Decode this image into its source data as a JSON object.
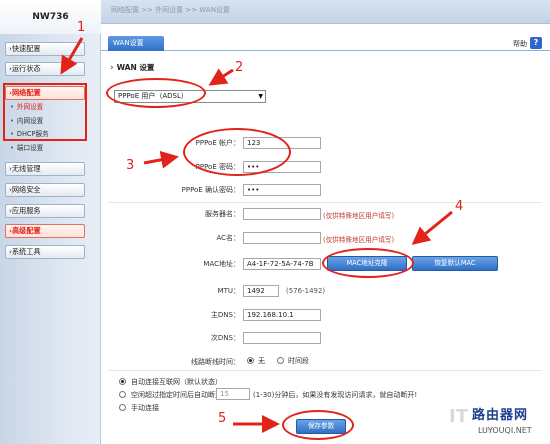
{
  "sidebar": {
    "brand": "NW736",
    "menus": [
      {
        "label": "›快速配置"
      },
      {
        "label": "›运行状态"
      },
      {
        "label": "›网络配置"
      },
      {
        "label": "›无线管理"
      },
      {
        "label": "›网络安全"
      },
      {
        "label": "›应用服务"
      },
      {
        "label": "›高级配置"
      },
      {
        "label": "›系统工具"
      }
    ],
    "submenus": [
      {
        "label": "外网设置"
      },
      {
        "label": "内网设置"
      },
      {
        "label": "DHCP服务"
      },
      {
        "label": "端口设置"
      }
    ]
  },
  "topbar": {
    "breadcrumb": "网络配置 >> 外网设置 >> WAN设置"
  },
  "tab": {
    "label": "WAN设置"
  },
  "help": {
    "label": "帮助"
  },
  "section": {
    "title": "WAN 设置"
  },
  "wan_type": {
    "value": "PPPoE 用户（ADSL）"
  },
  "form": {
    "pppoe_account_label": "PPPoE 帐户：",
    "pppoe_account_value": "123",
    "pppoe_password_label": "PPPoE 密码：",
    "pppoe_password_value": "•••",
    "pppoe_confirm_label": "PPPoE 确认密码：",
    "pppoe_confirm_value": "•••",
    "service_label": "服务器名：",
    "service_value": "",
    "service_hint": "(仅供特殊地区用户填写)",
    "ac_label": "AC名：",
    "ac_value": "",
    "ac_hint": "(仅供特殊地区用户填写)",
    "mac_label": "MAC地址：",
    "mac_value": "A4-1F-72-5A-74-7B",
    "mac_clone_button": "MAC地址克隆",
    "mac_restore_button": "恢复默认MAC",
    "mtu_label": "MTU：",
    "mtu_value": "1492",
    "mtu_range": "(576-1492)",
    "dns1_label": "主DNS：",
    "dns1_value": "192.168.10.1",
    "dns2_label": "次DNS：",
    "dns2_value": "",
    "offline_label": "线路断线时间：",
    "offline_options": [
      "无",
      "时间段"
    ],
    "connect_mode": [
      "自动连接互联网（默认状态）",
      "空闲超过指定时间后自动断开 在",
      "手动连接"
    ],
    "idle_value": "15",
    "idle_note": "(1-30)分钟后，如果没有发现访问请求，就自动断开!",
    "save_button": "保存参数"
  },
  "annotations": [
    "1",
    "2",
    "3",
    "4",
    "5"
  ],
  "watermark": {
    "logo": "路由器网",
    "url": "LUYOUQI.NET",
    "ghost": "IT",
    "ghost_url": "com"
  },
  "colors": {
    "accent": "#2f6fc6",
    "annotation": "#e2231a",
    "hint": "#c0392b"
  }
}
